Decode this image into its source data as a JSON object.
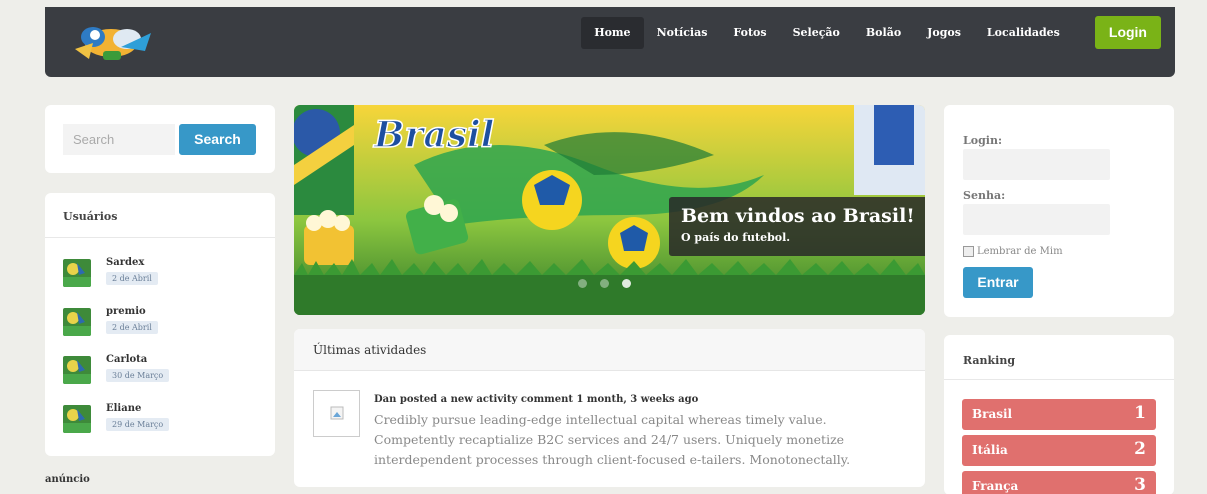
{
  "header": {
    "nav": [
      "Home",
      "Notícias",
      "Fotos",
      "Seleção",
      "Bolão",
      "Jogos",
      "Localidades"
    ],
    "login_label": "Login"
  },
  "search": {
    "placeholder": "Search",
    "button": "Search"
  },
  "users": {
    "title": "Usuários",
    "items": [
      {
        "name": "Sardex",
        "date": "2 de Abril"
      },
      {
        "name": "premio",
        "date": "2 de Abril"
      },
      {
        "name": "Carlota",
        "date": "30 de Março"
      },
      {
        "name": "Eliane",
        "date": "29 de Março"
      }
    ]
  },
  "ad_label": "anúncio",
  "hero": {
    "banner_text": "Brasil",
    "caption_title": "Bem vindos ao Brasil!",
    "caption_subtitle": "O país do futebol."
  },
  "activity": {
    "title": "Últimas atividades",
    "meta": "Dan posted a new activity comment 1 month, 3 weeks ago",
    "text": "Credibly pursue leading-edge intellectual capital whereas timely value. Competently recaptialize B2C services and 24/7 users. Uniquely monetize interdependent processes through client-focused e-tailers. Monotonectally."
  },
  "login_form": {
    "login_label": "Login:",
    "password_label": "Senha:",
    "remember_label": "Lembrar de Mim",
    "submit": "Entrar"
  },
  "ranking": {
    "title": "Ranking",
    "items": [
      {
        "name": "Brasil",
        "pos": "1"
      },
      {
        "name": "Itália",
        "pos": "2"
      },
      {
        "name": "França",
        "pos": "3"
      }
    ]
  },
  "colors": {
    "topbar": "#3a3d42",
    "accent_green": "#7ab317",
    "accent_blue": "#3798c8",
    "rank_red": "#e0706e"
  }
}
